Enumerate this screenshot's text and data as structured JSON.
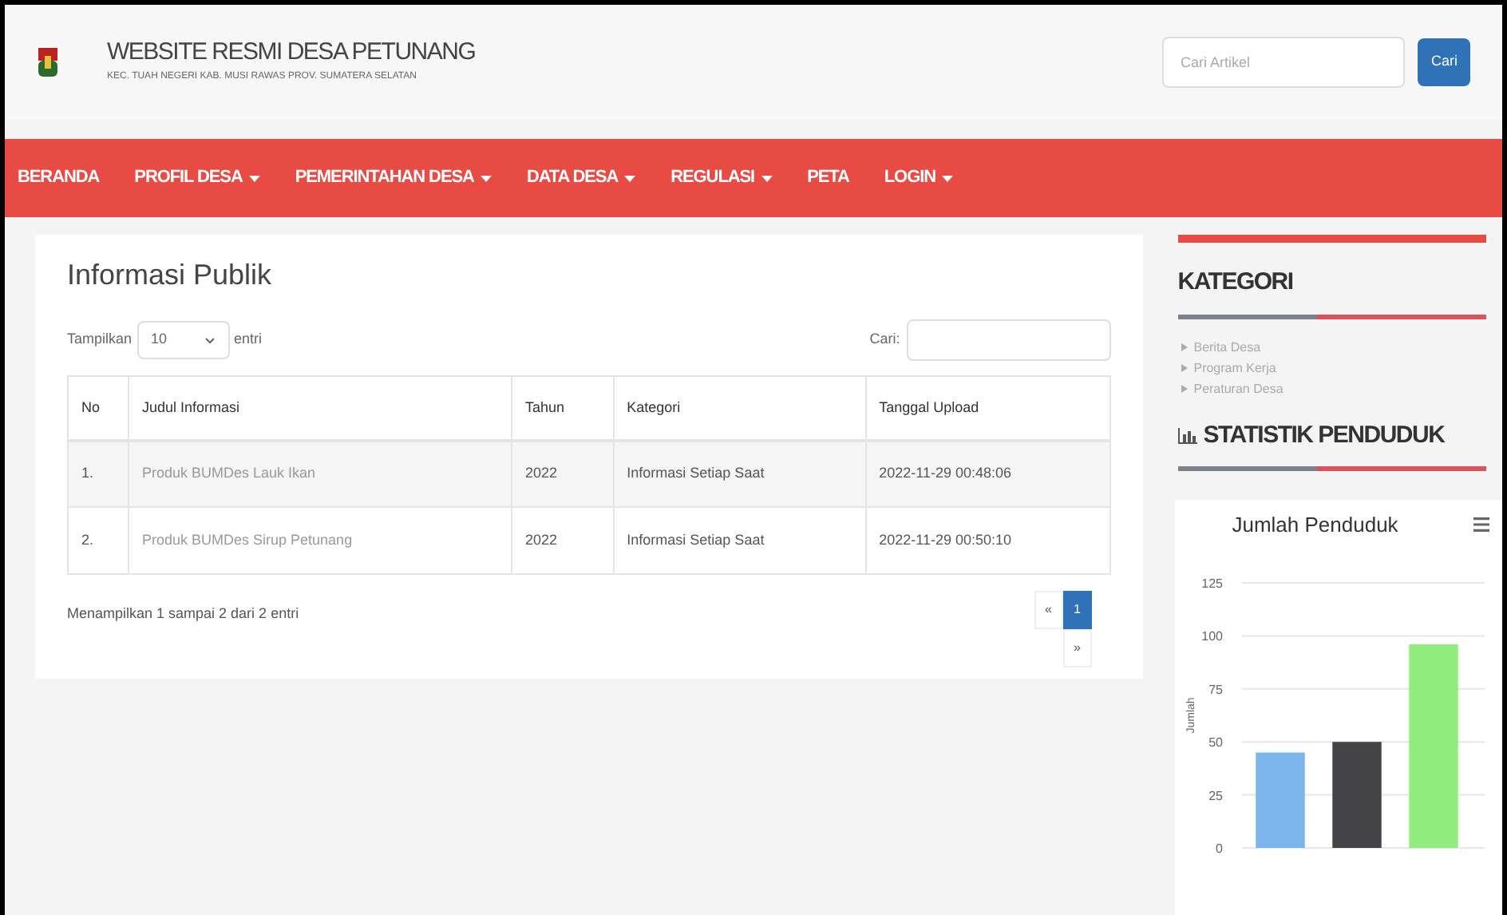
{
  "header": {
    "title": "WEBSITE RESMI DESA PETUNANG",
    "subtitle": "KEC. TUAH NEGERI KAB. MUSI RAWAS PROV. SUMATERA SELATAN",
    "search": {
      "placeholder": "Cari Artikel"
    },
    "search_button": "Cari"
  },
  "nav": [
    {
      "label": "BERANDA",
      "dropdown": false
    },
    {
      "label": "PROFIL DESA",
      "dropdown": true
    },
    {
      "label": "PEMERINTAHAN DESA",
      "dropdown": true
    },
    {
      "label": "DATA DESA",
      "dropdown": true
    },
    {
      "label": "REGULASI",
      "dropdown": true
    },
    {
      "label": "PETA",
      "dropdown": false
    },
    {
      "label": "LOGIN",
      "dropdown": true
    }
  ],
  "main": {
    "title": "Informasi Publik",
    "length_prefix": "Tampilkan",
    "length_value": "10",
    "length_suffix": "entri",
    "search_label": "Cari:",
    "table": {
      "columns": [
        "No",
        "Judul Informasi",
        "Tahun",
        "Kategori",
        "Tanggal Upload"
      ],
      "rows": [
        [
          "1.",
          "Produk BUMDes Lauk Ikan",
          "2022",
          "Informasi Setiap Saat",
          "2022-11-29 00:48:06"
        ],
        [
          "2.",
          "Produk BUMDes Sirup Petunang",
          "2022",
          "Informasi Setiap Saat",
          "2022-11-29 00:50:10"
        ]
      ]
    },
    "info": "Menampilkan 1 sampai 2 dari 2 entri",
    "pagination": [
      {
        "label": "«",
        "selected": false
      },
      {
        "label": "1",
        "selected": true
      },
      {
        "label": "»",
        "selected": false
      }
    ]
  },
  "sidebar": {
    "kategori_title": "KATEGORI",
    "kategori": [
      "Berita Desa",
      "Program Kerja",
      "Peraturan Desa"
    ],
    "statistik_title": "STATISTIK PENDUDUK",
    "chart_data": {
      "type": "bar",
      "grid": true,
      "title": "Jumlah Penduduk",
      "ylabel": "Jumlah",
      "ylim": [
        0,
        125
      ],
      "yticks": [
        0,
        25,
        50,
        75,
        100,
        125
      ],
      "series": [
        {
          "color": "#7cb5ec",
          "values": [
            45
          ]
        },
        {
          "color": "#434348",
          "values": [
            50
          ]
        },
        {
          "color": "#90ed7d",
          "values": [
            96
          ]
        }
      ]
    }
  }
}
